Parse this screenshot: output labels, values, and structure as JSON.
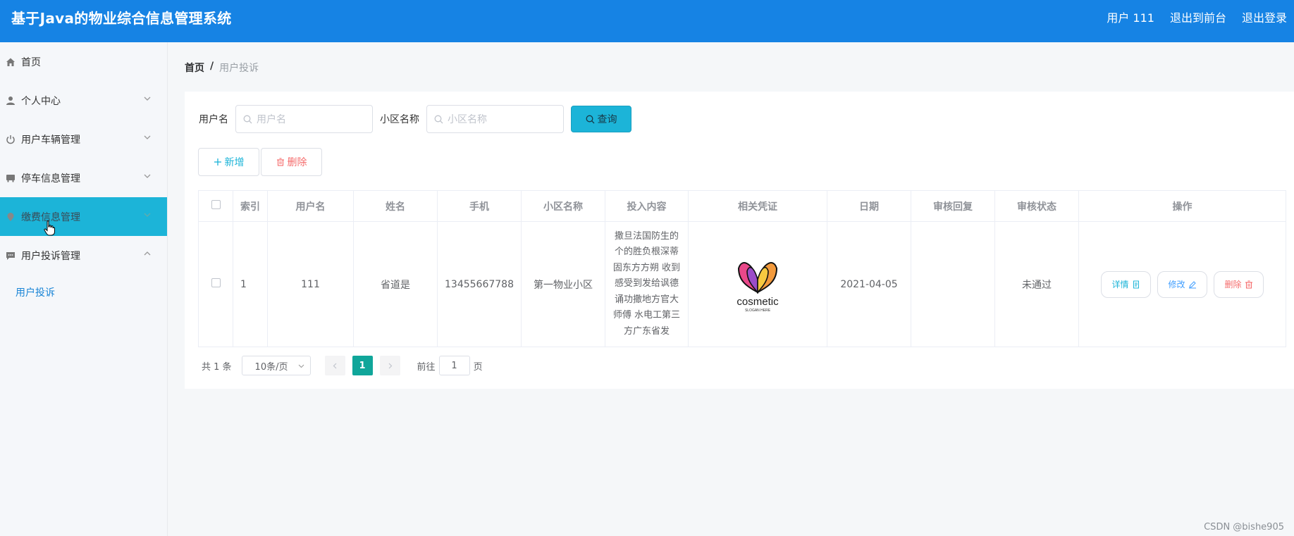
{
  "header": {
    "title": "基于Java的物业综合信息管理系统",
    "user_label": "用户 111",
    "back_to_front": "退出到前台",
    "logout": "退出登录"
  },
  "sidebar": {
    "items": [
      {
        "label": "首页",
        "icon": "home-icon"
      },
      {
        "label": "个人中心",
        "icon": "user-icon"
      },
      {
        "label": "用户车辆管理",
        "icon": "power-icon"
      },
      {
        "label": "停车信息管理",
        "icon": "parking-icon"
      },
      {
        "label": "缴费信息管理",
        "icon": "location-icon"
      },
      {
        "label": "用户投诉管理",
        "icon": "chat-icon"
      }
    ],
    "sub_item": "用户投诉"
  },
  "breadcrumb": {
    "home": "首页",
    "separator": "/",
    "current": "用户投诉"
  },
  "search": {
    "username_label": "用户名",
    "username_placeholder": "用户名",
    "community_label": "小区名称",
    "community_placeholder": "小区名称",
    "query_button": "查询"
  },
  "actions": {
    "add": "新增",
    "delete": "删除"
  },
  "table": {
    "headers": [
      "索引",
      "用户名",
      "姓名",
      "手机",
      "小区名称",
      "投入内容",
      "相关凭证",
      "日期",
      "审核回复",
      "审核状态",
      "操作"
    ],
    "rows": [
      {
        "index": "1",
        "username": "111",
        "name": "省道是",
        "phone": "13455667788",
        "community": "第一物业小区",
        "content": "撒旦法国防生的个的胜负根深蒂固东方方朔 收到感受到发给讽德诵功撒地方官大师傅 水电工第三方广东省发",
        "proof_logo_text": "cosmetic",
        "proof_logo_sub": "SLOGAN HERE",
        "date": "2021-04-05",
        "reply": "",
        "status": "未通过",
        "ops": {
          "detail": "详情",
          "edit": "修改",
          "delete": "删除"
        }
      }
    ]
  },
  "pagination": {
    "total": "共 1 条",
    "page_size": "10条/页",
    "current_page": "1",
    "goto_label": "前往",
    "goto_value": "1",
    "page_unit": "页"
  },
  "watermark": "CSDN @bishe905",
  "colors": {
    "topbar": "#1683e4",
    "accent": "#1cb4d8",
    "danger": "#f56c6c",
    "page_active": "#10a69a"
  }
}
